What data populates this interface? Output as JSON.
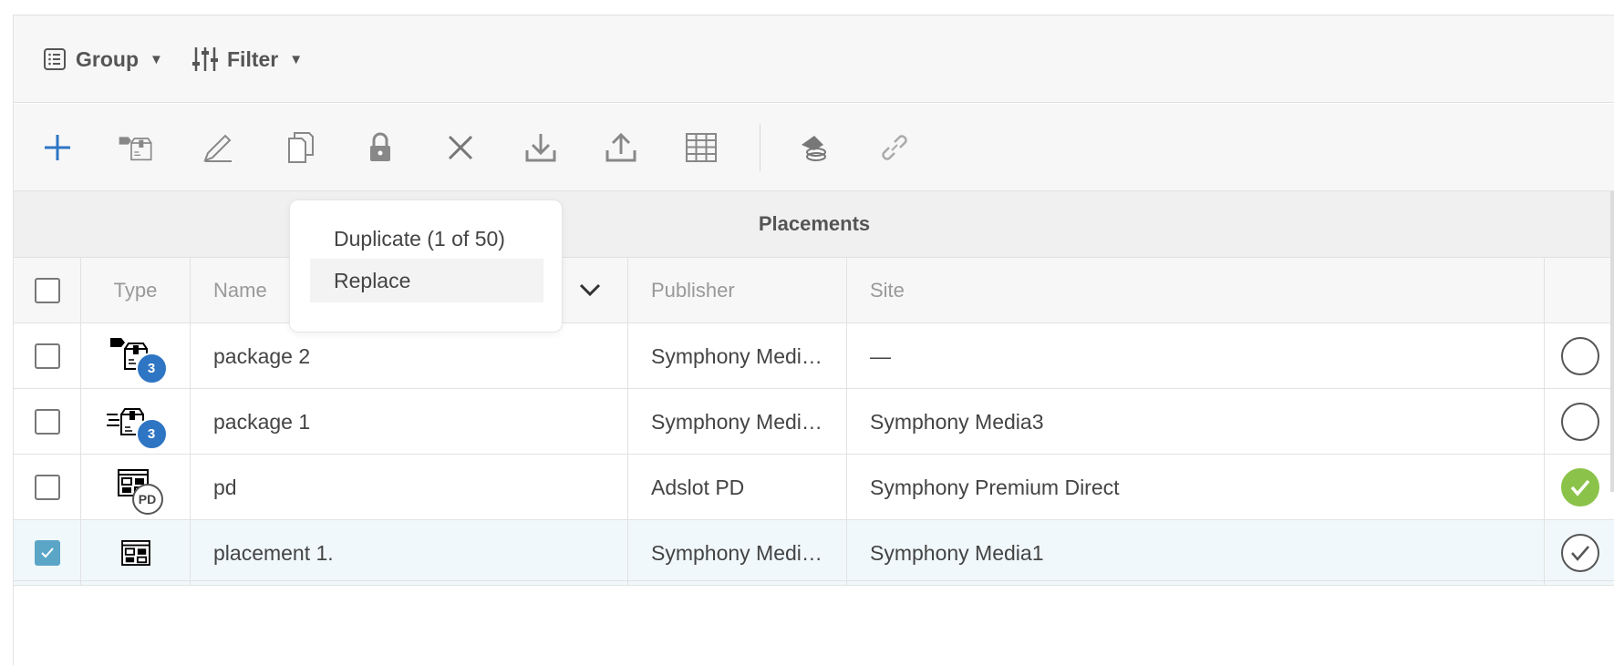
{
  "topbar": {
    "group_label": "Group",
    "filter_label": "Filter",
    "group_icon": "list-icon",
    "filter_icon": "sliders-icon"
  },
  "toolbar": {
    "tools": [
      "add-icon",
      "package-tag-icon",
      "pencil-icon",
      "copy-icon",
      "lock-icon",
      "close-icon",
      "download-icon",
      "upload-icon",
      "grid-icon",
      "eraser-icon",
      "link-icon"
    ]
  },
  "dropdown": {
    "items": [
      {
        "label": "Duplicate (1 of 50)"
      },
      {
        "label": "Replace"
      }
    ]
  },
  "section": {
    "title": "Placements"
  },
  "table": {
    "columns": {
      "type": "Type",
      "name": "Name",
      "publisher": "Publisher",
      "site": "Site"
    },
    "rows": [
      {
        "name": "package 2",
        "publisher": "Symphony Medi…",
        "site": "—",
        "badge": "3",
        "selected": false,
        "status": "empty"
      },
      {
        "name": "package 1",
        "publisher": "Symphony Medi…",
        "site": "Symphony Media3",
        "badge": "3",
        "selected": false,
        "status": "empty"
      },
      {
        "name": "pd",
        "publisher": "Adslot PD",
        "site": "Symphony Premium Direct",
        "badge": "PD",
        "selected": false,
        "status": "active"
      },
      {
        "name": "placement 1.",
        "publisher": "Symphony Medi…",
        "site": "Symphony Media1",
        "badge": "",
        "selected": true,
        "status": "checked"
      }
    ]
  },
  "colors": {
    "accent_blue": "#2e75c4",
    "checkbox_checked": "#5ba6c7",
    "status_green": "#8bc34a",
    "selected_row": "#f0f8fb"
  }
}
